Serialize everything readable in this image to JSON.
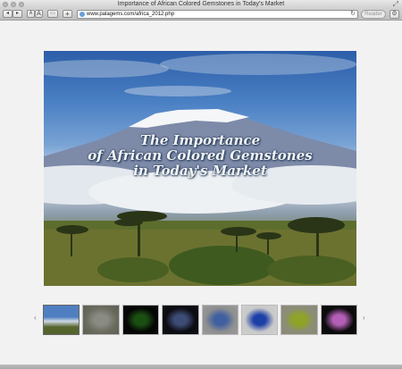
{
  "window": {
    "title": "Importance of African Colored Gemstones in Today's Market"
  },
  "toolbar": {
    "back_label": "◂",
    "forward_label": "▸",
    "text_smaller_label": "A",
    "text_larger_label": "A",
    "bookmarks_label": "▭",
    "add_label": "+",
    "url": "www.palagems.com/africa_2012.php",
    "reader_label": "Reader",
    "reload_label": "↻",
    "settings_label": "⚙"
  },
  "hero": {
    "title": "The Importance\nof African Colored Gemstones\nin Today's Market"
  },
  "gallery": {
    "prev_label": "‹",
    "next_label": "›",
    "thumbnails": [
      {
        "name": "kilimanjaro",
        "colors": [
          "#4f7fc0",
          "#cfd9e4",
          "#55652c"
        ]
      },
      {
        "name": "text-slide",
        "colors": [
          "#6b6b5e",
          "#8a8c84",
          "#5c5f55"
        ]
      },
      {
        "name": "green-gems",
        "colors": [
          "#050505",
          "#1b4f12",
          "#0a0a0a"
        ]
      },
      {
        "name": "blue-crystal",
        "colors": [
          "#0b0b12",
          "#3d4c74",
          "#101018"
        ]
      },
      {
        "name": "tanzanite-rough",
        "colors": [
          "#8f8f8f",
          "#3f5fa0",
          "#9a9a9a"
        ]
      },
      {
        "name": "blue-sapphire",
        "colors": [
          "#c9c9c9",
          "#1c3fa8",
          "#cfcfcf"
        ]
      },
      {
        "name": "green-garnet",
        "colors": [
          "#8c8c7a",
          "#8fa326",
          "#8a8a76"
        ]
      },
      {
        "name": "pink-spinel",
        "colors": [
          "#0b0b0b",
          "#b35fb6",
          "#0d0d0d"
        ]
      }
    ]
  }
}
